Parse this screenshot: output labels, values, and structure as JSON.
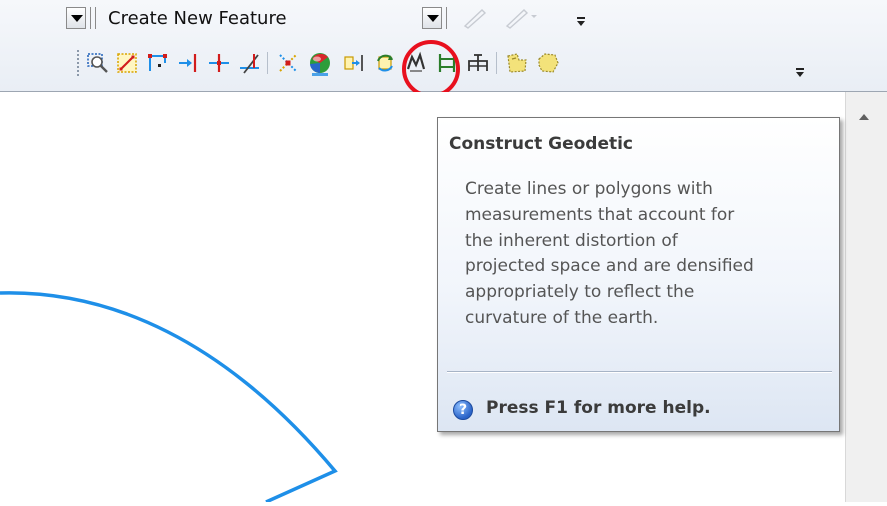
{
  "template_bar": {
    "selected_template": "Create New Feature"
  },
  "toolbar": {
    "buttons": [
      {
        "icon": "edit-vertices-icon"
      },
      {
        "icon": "reshape-feature-icon"
      },
      {
        "icon": "cut-polygons-icon"
      },
      {
        "icon": "extend-icon"
      },
      {
        "icon": "split-tool-icon"
      },
      {
        "icon": "trim-icon"
      },
      {
        "icon": "intersection-icon"
      },
      {
        "icon": "construct-geodetic-icon",
        "highlighted": true
      },
      {
        "icon": "align-to-shape-icon"
      },
      {
        "icon": "rotate-icon"
      },
      {
        "icon": "generalize-icon"
      },
      {
        "icon": "buffer-icon"
      },
      {
        "icon": "copy-parallel-icon"
      },
      {
        "icon": "merge-icon"
      },
      {
        "icon": "union-icon"
      }
    ],
    "highlight_color": "#e8101e"
  },
  "tooltip": {
    "title": "Construct Geodetic",
    "body_lines": [
      "Create lines or polygons with",
      "measurements that account for",
      "the inherent distortion of",
      "projected space and are densified",
      "appropriately to reflect the",
      "curvature of the earth."
    ],
    "help_text": "Press F1 for more help.",
    "help_icon": "?"
  },
  "map": {
    "feature_color": "#1e8fe8"
  }
}
